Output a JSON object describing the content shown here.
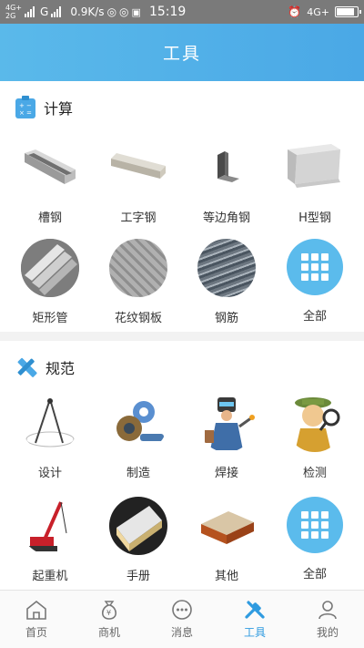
{
  "status": {
    "net_top": "4G+",
    "net_bottom": "2G",
    "carrier2": "G",
    "speed": "0.9K/s",
    "time": "15:19",
    "net_right": "4G+",
    "battery_level": 0.9
  },
  "header": {
    "title": "工具"
  },
  "calc": {
    "title": "计算",
    "items": [
      {
        "label": "槽钢",
        "icon": "channel-steel"
      },
      {
        "label": "工字钢",
        "icon": "i-beam"
      },
      {
        "label": "等边角钢",
        "icon": "angle-steel"
      },
      {
        "label": "H型钢",
        "icon": "h-beam"
      },
      {
        "label": "矩形管",
        "icon": "rect-tube"
      },
      {
        "label": "花纹钢板",
        "icon": "checker-plate"
      },
      {
        "label": "钢筋",
        "icon": "rebar"
      },
      {
        "label": "全部",
        "icon": "grid-all"
      }
    ]
  },
  "spec": {
    "title": "规范",
    "items": [
      {
        "label": "设计",
        "icon": "compass"
      },
      {
        "label": "制造",
        "icon": "gears"
      },
      {
        "label": "焊接",
        "icon": "welder"
      },
      {
        "label": "检测",
        "icon": "inspector"
      },
      {
        "label": "起重机",
        "icon": "crane"
      },
      {
        "label": "手册",
        "icon": "book"
      },
      {
        "label": "其他",
        "icon": "board"
      },
      {
        "label": "全部",
        "icon": "grid-all"
      }
    ]
  },
  "tabs": [
    {
      "label": "首页",
      "icon": "home-icon"
    },
    {
      "label": "商机",
      "icon": "money-bag-icon"
    },
    {
      "label": "消息",
      "icon": "chat-icon"
    },
    {
      "label": "工具",
      "icon": "tools-icon",
      "active": true
    },
    {
      "label": "我的",
      "icon": "user-icon"
    }
  ],
  "colors": {
    "accent": "#4aa8e6",
    "active_tab": "#2f9be0",
    "all_button": "#5bbbec"
  }
}
